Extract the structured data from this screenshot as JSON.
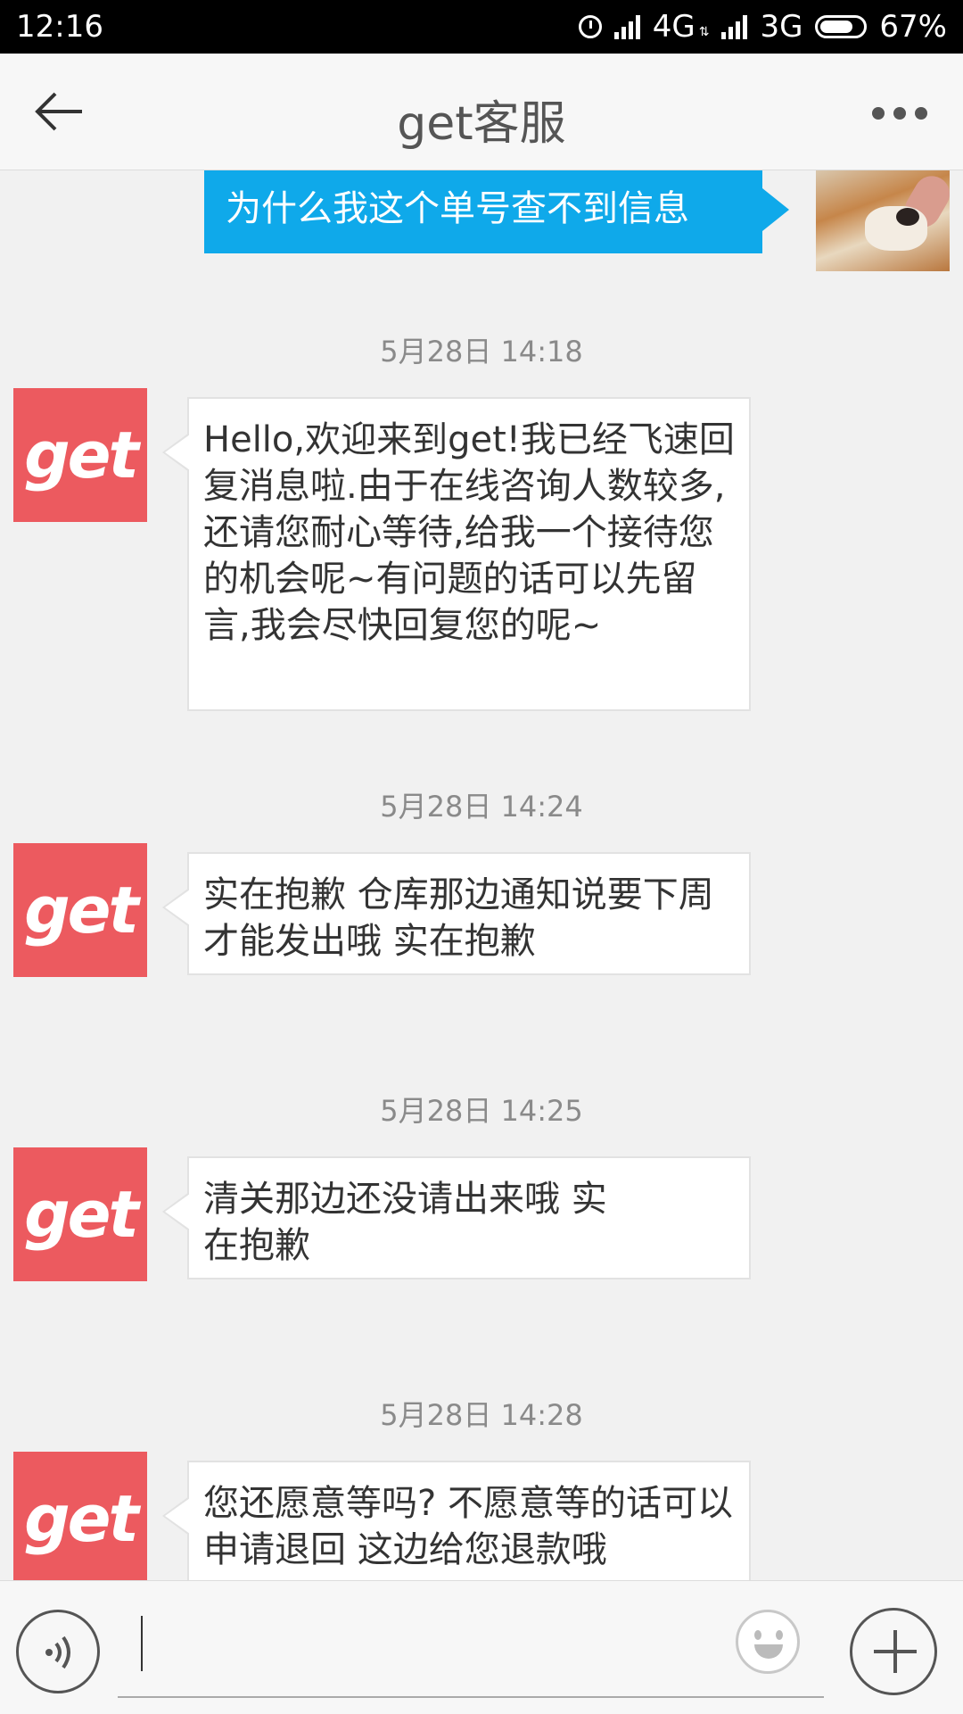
{
  "status_bar": {
    "time": "12:16",
    "network_1": "4G",
    "network_2": "3G",
    "battery": "67%"
  },
  "header": {
    "title": "get客服"
  },
  "messages": [
    {
      "side": "right",
      "text": "为什么我这个单号查不到信息"
    },
    {
      "timestamp": "5月28日 14:18",
      "sender": "get",
      "text": "Hello,欢迎来到get!我已经飞速回复消息啦.由于在线咨询人数较多,还请您耐心等待,给我一个接待您的机会呢~有问题的话可以先留言,我会尽快回复您的呢~"
    },
    {
      "timestamp": "5月28日 14:24",
      "sender": "get",
      "text": "实在抱歉 仓库那边通知说要下周才能发出哦 实在抱歉"
    },
    {
      "timestamp": "5月28日 14:25",
      "sender": "get",
      "text": "清关那边还没请出来哦 实在抱歉"
    },
    {
      "timestamp": "5月28日 14:28",
      "sender": "get",
      "text": "您还愿意等吗? 不愿意等的话可以申请退回 这边给您退款哦"
    }
  ],
  "colors": {
    "sent_bubble": "#0fa9ea",
    "brand_avatar": "#ec5a5f"
  },
  "icons": {
    "back": "arrow-left",
    "more": "three-dots",
    "voice": "voice-wave",
    "emoji": "smiley",
    "add": "plus"
  }
}
